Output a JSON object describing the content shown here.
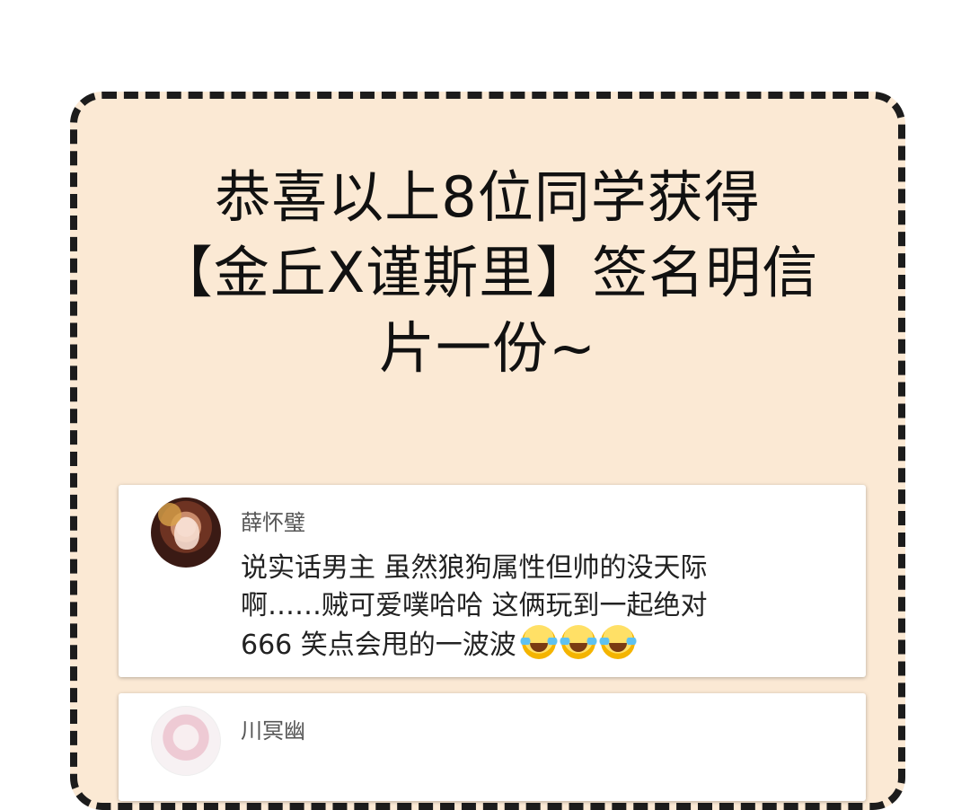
{
  "headline": {
    "line1": "恭喜以上8位同学获得",
    "line2": "【金丘X谨斯里】签名明信",
    "line3": "片一份~"
  },
  "comments": [
    {
      "username": "薛怀璧",
      "text_lines": [
        "说实话男主 虽然狼狗属性但帅的没天际",
        "啊……贼可爱噗哈哈 这俩玩到一起绝对",
        "666 笑点会甩的一波波"
      ],
      "emojis": [
        "laughing-crying-emoji",
        "laughing-crying-emoji",
        "laughing-crying-emoji"
      ]
    },
    {
      "username": "川冥幽"
    }
  ],
  "colors": {
    "panel_background": "#fbe9d4",
    "panel_border": "#1c1c1c",
    "card_background": "#ffffff",
    "text_primary": "#222222",
    "text_username": "#555555"
  }
}
